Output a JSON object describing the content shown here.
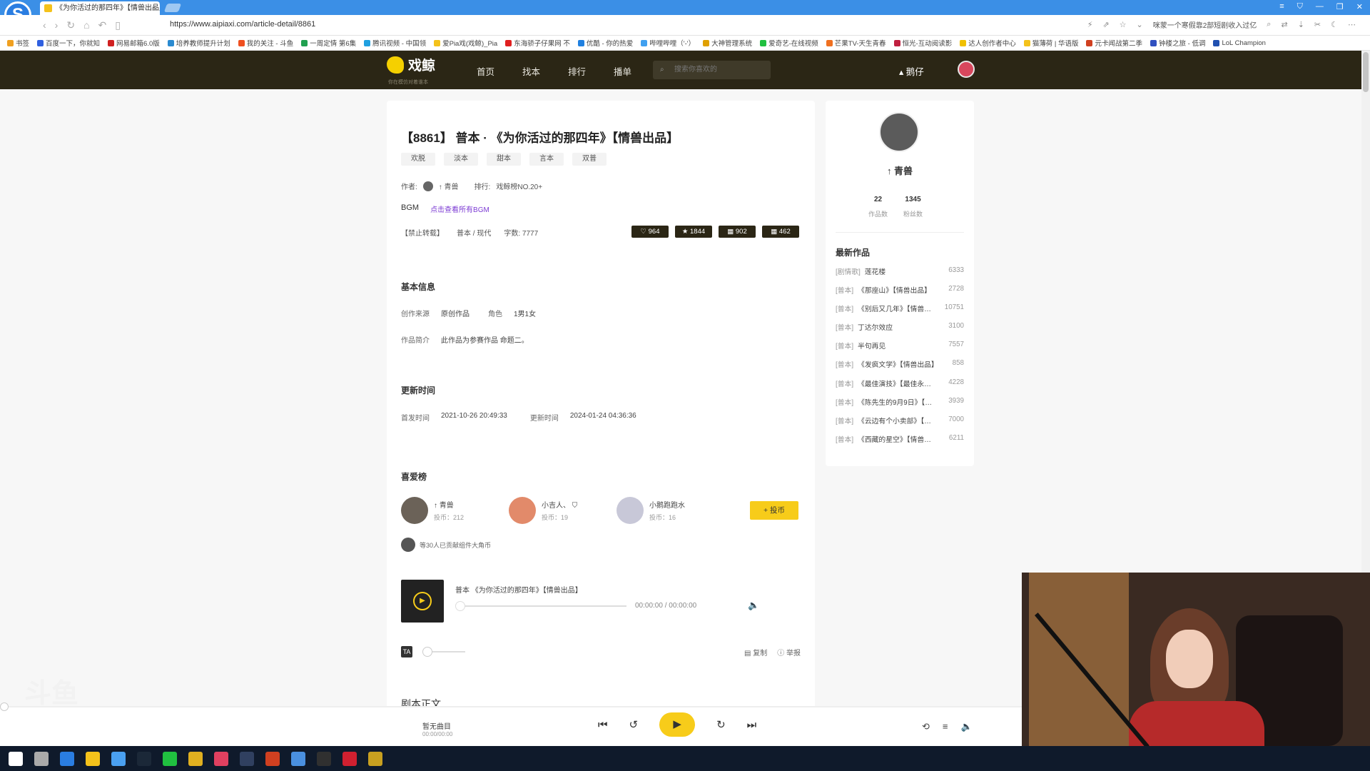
{
  "browser": {
    "tab_title": "《为你活过的那四年》【情兽出品】",
    "tab_close": "×",
    "url": "https://www.aipiaxi.com/article-detail/8861",
    "promo_text": "咪蒙一个寒假靠2部短剧收入过亿",
    "win_controls": [
      "≡",
      "⛉",
      "—",
      "❐",
      "✕"
    ]
  },
  "bookmarks": [
    {
      "label": "书签",
      "color": "#f0a020"
    },
    {
      "label": "百度一下，你就知",
      "color": "#3060e0"
    },
    {
      "label": "网易邮箱6.0版",
      "color": "#d02020"
    },
    {
      "label": "培养教师提升计划",
      "color": "#2a8ad0"
    },
    {
      "label": "我的关注 - 斗鱼",
      "color": "#f05020"
    },
    {
      "label": "一周定情 第6集",
      "color": "#20a050"
    },
    {
      "label": "腾讯视频 - 中国领",
      "color": "#20a0e0"
    },
    {
      "label": "爱Pia戏(戏鲸)_Pia",
      "color": "#f4c21b"
    },
    {
      "label": "东海骄子仔果网 不",
      "color": "#e02020"
    },
    {
      "label": "优酷 - 你的热爱",
      "color": "#2080e0"
    },
    {
      "label": "哔哩哔哩（'-'）",
      "color": "#40a0f0"
    },
    {
      "label": "大神管理系统",
      "color": "#e0a000"
    },
    {
      "label": "爱奇艺-在线视频",
      "color": "#20c040"
    },
    {
      "label": "芒果TV-天生青春",
      "color": "#f07020"
    },
    {
      "label": "恒光-互动阅读影",
      "color": "#c02040"
    },
    {
      "label": "达人创作者中心",
      "color": "#f0c000"
    },
    {
      "label": "猫薄荷 | 华语版",
      "color": "#f4c21b"
    },
    {
      "label": "元卡闻战第二季",
      "color": "#d04020"
    },
    {
      "label": "钟楼之旅 - 低调",
      "color": "#3050c0"
    },
    {
      "label": "LoL Champion",
      "color": "#2050b0"
    }
  ],
  "site": {
    "name": "戏鲸",
    "slogan": "你在模仿对着谁本",
    "menu": [
      "首页",
      "找本",
      "排行",
      "播单"
    ],
    "search_placeholder": "搜索你喜欢的",
    "user_nick": "鹅仔"
  },
  "article": {
    "title": "【8861】 普本 · 《为你活过的那四年》【情兽出品】",
    "tags": [
      "欢脱",
      "淡本",
      "甜本",
      "言本",
      "双普"
    ],
    "author_label": "作者:",
    "author_name": "↑ 青兽",
    "rank_label": "排行:",
    "rank_value": "戏鲸榜NO.20+",
    "bgm_label": "BGM",
    "bgm_link": "点击查看所有BGM",
    "no_repost": "【禁止转载】",
    "category": "普本 / 现代",
    "word_count": "字数: 7777",
    "stats": [
      "♡ 964",
      "★ 1844",
      "▦ 902",
      "▦ 462"
    ],
    "basic_info_h": "基本信息",
    "source_label": "创作来源",
    "source_value": "原创作品",
    "role_label": "角色",
    "role_value": "1男1女",
    "intro_label": "作品简介",
    "intro_value": "此作品为参赛作品 命题二。",
    "update_h": "更新时间",
    "first_label": "首发时间",
    "first_value": "2021-10-26 20:49:33",
    "update_label": "更新时间",
    "update_value": "2024-01-24 04:36:36",
    "fans_h": "喜爱榜",
    "fans": [
      {
        "name": "↑ 青兽",
        "coins": "投币：212",
        "color": "#6b6258"
      },
      {
        "name": "小吉人、",
        "coins": "投币：19",
        "color": "#e28a6a"
      },
      {
        "name": "小鹅跑跑水",
        "coins": "投币：16",
        "color": "#c8c8d8"
      }
    ],
    "vote_label": "+ 投币",
    "contrib_text": "等30人已贡献组件大角币",
    "player_title": "普本 《为你活过的那四年》【情兽出品】",
    "player_time": "00:00:00  /  00:00:00",
    "font_icon": "TA",
    "copy_label": "复制",
    "report_label": "举报",
    "body_h": "剧本正文"
  },
  "sidebar": {
    "name": "↑ 青兽",
    "works_count": "22",
    "works_label": "作品数",
    "fans_count": "1345",
    "fans_label": "粉丝数",
    "latest_h": "最新作品",
    "works": [
      {
        "cat": "[剧情歌]",
        "title": "莲花楼",
        "count": "6333"
      },
      {
        "cat": "[普本]",
        "title": "《那座山》【情兽出品】",
        "count": "2728"
      },
      {
        "cat": "[普本]",
        "title": "《别后又几年》【情兽…",
        "count": "10751"
      },
      {
        "cat": "[普本]",
        "title": "丁达尔效应",
        "count": "3100"
      },
      {
        "cat": "[普本]",
        "title": "半句再见",
        "count": "7557"
      },
      {
        "cat": "[普本]",
        "title": "《发疯文学》【情兽出品】",
        "count": "858"
      },
      {
        "cat": "[普本]",
        "title": "《最佳演技》【最佳永…",
        "count": "4228"
      },
      {
        "cat": "[普本]",
        "title": "《陈先生的9月9日》【…",
        "count": "3939"
      },
      {
        "cat": "[普本]",
        "title": "《云边有个小卖部》【…",
        "count": "7000"
      },
      {
        "cat": "[普本]",
        "title": "《西藏的星空》【情兽…",
        "count": "6211"
      }
    ]
  },
  "bottom_player": {
    "song": "暂无曲目",
    "time": "00:00/00:00"
  },
  "taskbar_icons": [
    {
      "name": "windows-start-icon",
      "color": "#ffffff"
    },
    {
      "name": "task-view-icon",
      "color": "#aaaaaa"
    },
    {
      "name": "kugou-icon",
      "color": "#2a7de1"
    },
    {
      "name": "file-explorer-icon",
      "color": "#f4c21b"
    },
    {
      "name": "sogou-browser-icon",
      "color": "#4aa0f0"
    },
    {
      "name": "steam-icon",
      "color": "#1b2838"
    },
    {
      "name": "wechat-icon",
      "color": "#20c040"
    },
    {
      "name": "chrome-icon",
      "color": "#e0b020"
    },
    {
      "name": "app-red-icon",
      "color": "#e04060"
    },
    {
      "name": "app-dark-icon",
      "color": "#304060"
    },
    {
      "name": "app-shield-icon",
      "color": "#d04020"
    },
    {
      "name": "sogou-browser-active-icon",
      "color": "#4a90e0"
    },
    {
      "name": "obs-icon",
      "color": "#303030"
    },
    {
      "name": "app-bird-icon",
      "color": "#d02030"
    },
    {
      "name": "app-face-icon",
      "color": "#c8a020"
    }
  ]
}
